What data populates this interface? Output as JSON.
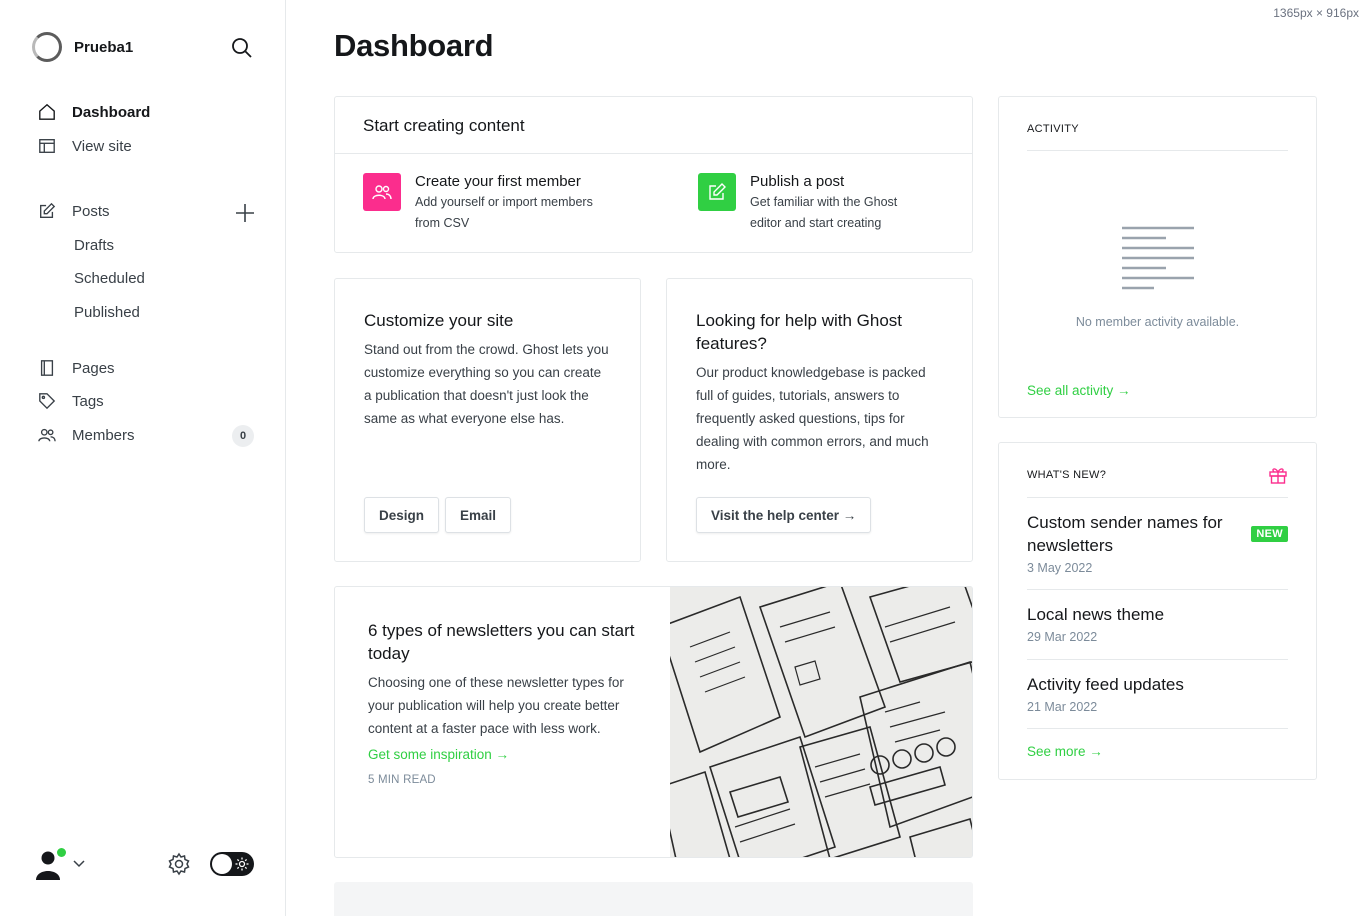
{
  "dims_label": "1365px × 916px",
  "sidebar": {
    "site_name": "Prueba1",
    "nav": {
      "dashboard": "Dashboard",
      "view_site": "View site",
      "posts": "Posts",
      "drafts": "Drafts",
      "scheduled": "Scheduled",
      "published": "Published",
      "pages": "Pages",
      "tags": "Tags",
      "members": "Members",
      "members_count": "0"
    }
  },
  "main": {
    "title": "Dashboard",
    "start": {
      "heading": "Start creating content",
      "member_title": "Create your first member",
      "member_desc_1": "Add yourself or import members",
      "member_desc_2": "from CSV",
      "post_title": "Publish a post",
      "post_desc_1": "Get familiar with the Ghost",
      "post_desc_2": "editor and start creating"
    },
    "customize": {
      "heading": "Customize your site",
      "body": "Stand out from the crowd. Ghost lets you customize everything so you can create a publication that doesn't just look the same as what everyone else has.",
      "design_btn": "Design",
      "email_btn": "Email"
    },
    "help": {
      "heading": "Looking for help with Ghost features?",
      "body": "Our product knowledgebase is packed full of guides, tutorials, answers to frequently asked questions, tips for dealing with common errors, and much more.",
      "btn": "Visit the help center →"
    },
    "news": {
      "heading": "6 types of newsletters you can start today",
      "body": "Choosing one of these newsletter types for your publication will help you create better content at a faster pace with less work.",
      "link": "Get some inspiration →",
      "read": "5 MIN READ"
    }
  },
  "activity": {
    "label": "ACTIVITY",
    "empty": "No member activity available.",
    "link": "See all activity →"
  },
  "whatsnew": {
    "label": "WHAT'S NEW?",
    "items": [
      {
        "title": "Custom sender names for newsletters",
        "date": "3 May 2022",
        "badge": "NEW"
      },
      {
        "title": "Local news theme",
        "date": "29 Mar 2022"
      },
      {
        "title": "Activity feed updates",
        "date": "21 Mar 2022"
      }
    ],
    "link": "See more →"
  },
  "colors": {
    "accent_green": "#30cf43",
    "member_pink": "#fb2d8d",
    "post_green": "#30cf43"
  }
}
